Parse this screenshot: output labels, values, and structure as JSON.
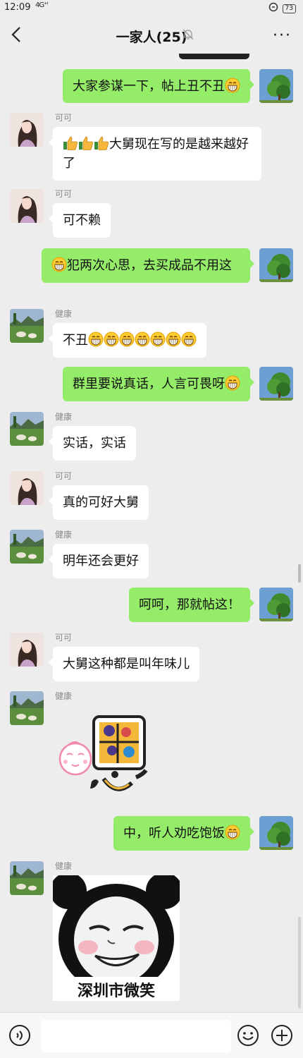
{
  "status": {
    "time": "12:09",
    "signal": "4G⁺ᴵ",
    "battery": "73"
  },
  "header": {
    "title": "一家人(25)"
  },
  "senders": {
    "keke": "可可",
    "jiankang": "健康"
  },
  "messages": [
    {
      "side": "right",
      "text": "大家参谋一下，帖上丑不丑",
      "emoji_after": 1
    },
    {
      "side": "left",
      "sender": "可可",
      "thumbs_before": 3,
      "text": "大舅现在写的是越来越好了"
    },
    {
      "side": "left",
      "sender": "可可",
      "text": "可不赖"
    },
    {
      "side": "right",
      "emoji_before": 1,
      "text": "犯两次心思，去买成品不用这"
    },
    {
      "side": "left",
      "sender": "健康",
      "text": "不丑",
      "emoji_after": 7
    },
    {
      "side": "right",
      "text": "群里要说真话，人言可畏呀",
      "emoji_after": 1
    },
    {
      "side": "left",
      "sender": "健康",
      "text": "实话，实话"
    },
    {
      "side": "left",
      "sender": "可可",
      "text": "真的可好大舅"
    },
    {
      "side": "left",
      "sender": "健康",
      "text": "明年还会更好"
    },
    {
      "side": "right",
      "text": "呵呵，那就帖这！"
    },
    {
      "side": "left",
      "sender": "可可",
      "text": "大舅这种都是叫年味儿"
    },
    {
      "side": "left",
      "sender": "健康",
      "sticker": "sticker-good"
    },
    {
      "side": "right",
      "text": "中，听人劝吃饱饭",
      "emoji_after": 1
    },
    {
      "side": "left",
      "sender": "健康",
      "sticker": "sticker-panda",
      "sticker_caption": "深圳市微笑"
    }
  ],
  "colors": {
    "self_bubble": "#95ec69",
    "other_bubble": "#ffffff",
    "background": "#ededed"
  },
  "icons": [
    "back-icon",
    "mute-bell-icon",
    "more-icon",
    "voice-icon",
    "emoji-icon",
    "plus-icon"
  ]
}
